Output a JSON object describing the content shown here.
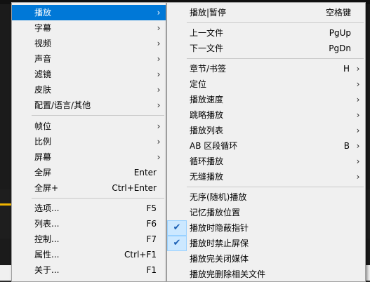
{
  "main_menu": {
    "items": [
      {
        "label": "播放",
        "submenu": true,
        "highlight": true
      },
      {
        "label": "字幕",
        "submenu": true
      },
      {
        "label": "视频",
        "submenu": true
      },
      {
        "label": "声音",
        "submenu": true
      },
      {
        "label": "滤镜",
        "submenu": true
      },
      {
        "label": "皮肤",
        "submenu": true
      },
      {
        "label": "配置/语言/其他",
        "submenu": true
      },
      {
        "label": "帧位",
        "submenu": true
      },
      {
        "label": "比例",
        "submenu": true
      },
      {
        "label": "屏幕",
        "submenu": true
      },
      {
        "label": "全屏",
        "shortcut": "Enter"
      },
      {
        "label": "全屏+",
        "shortcut": "Ctrl+Enter"
      },
      {
        "label": "选项...",
        "shortcut": "F5"
      },
      {
        "label": "列表...",
        "shortcut": "F6"
      },
      {
        "label": "控制...",
        "shortcut": "F7"
      },
      {
        "label": "属性...",
        "shortcut": "Ctrl+F1"
      },
      {
        "label": "关于...",
        "shortcut": "F1"
      }
    ]
  },
  "play_submenu": {
    "items": [
      {
        "label": "播放|暂停",
        "shortcut": "空格键"
      },
      {
        "label": "上一文件",
        "shortcut": "PgUp"
      },
      {
        "label": "下一文件",
        "shortcut": "PgDn"
      },
      {
        "label": "章节/书签",
        "shortcut": "H",
        "submenu": true
      },
      {
        "label": "定位",
        "submenu": true
      },
      {
        "label": "播放速度",
        "submenu": true
      },
      {
        "label": "跳略播放",
        "submenu": true
      },
      {
        "label": "播放列表",
        "submenu": true
      },
      {
        "label": "AB 区段循环",
        "shortcut": "B",
        "submenu": true
      },
      {
        "label": "循环播放",
        "submenu": true
      },
      {
        "label": "无缝播放",
        "submenu": true
      },
      {
        "label": "无序(随机)播放"
      },
      {
        "label": "记忆播放位置"
      },
      {
        "label": "播放时隐蔽指针",
        "checked": true
      },
      {
        "label": "播放时禁止屏保",
        "checked": true
      },
      {
        "label": "播放完关闭媒体"
      },
      {
        "label": "播放完删除相关文件"
      }
    ]
  },
  "icons": {
    "submenu_arrow": "chevron-right-icon",
    "check": "checkmark-icon"
  },
  "colors": {
    "highlight": "#0078d7",
    "menu_bg": "#f0f0f0",
    "check_bg": "#cce8ff"
  }
}
